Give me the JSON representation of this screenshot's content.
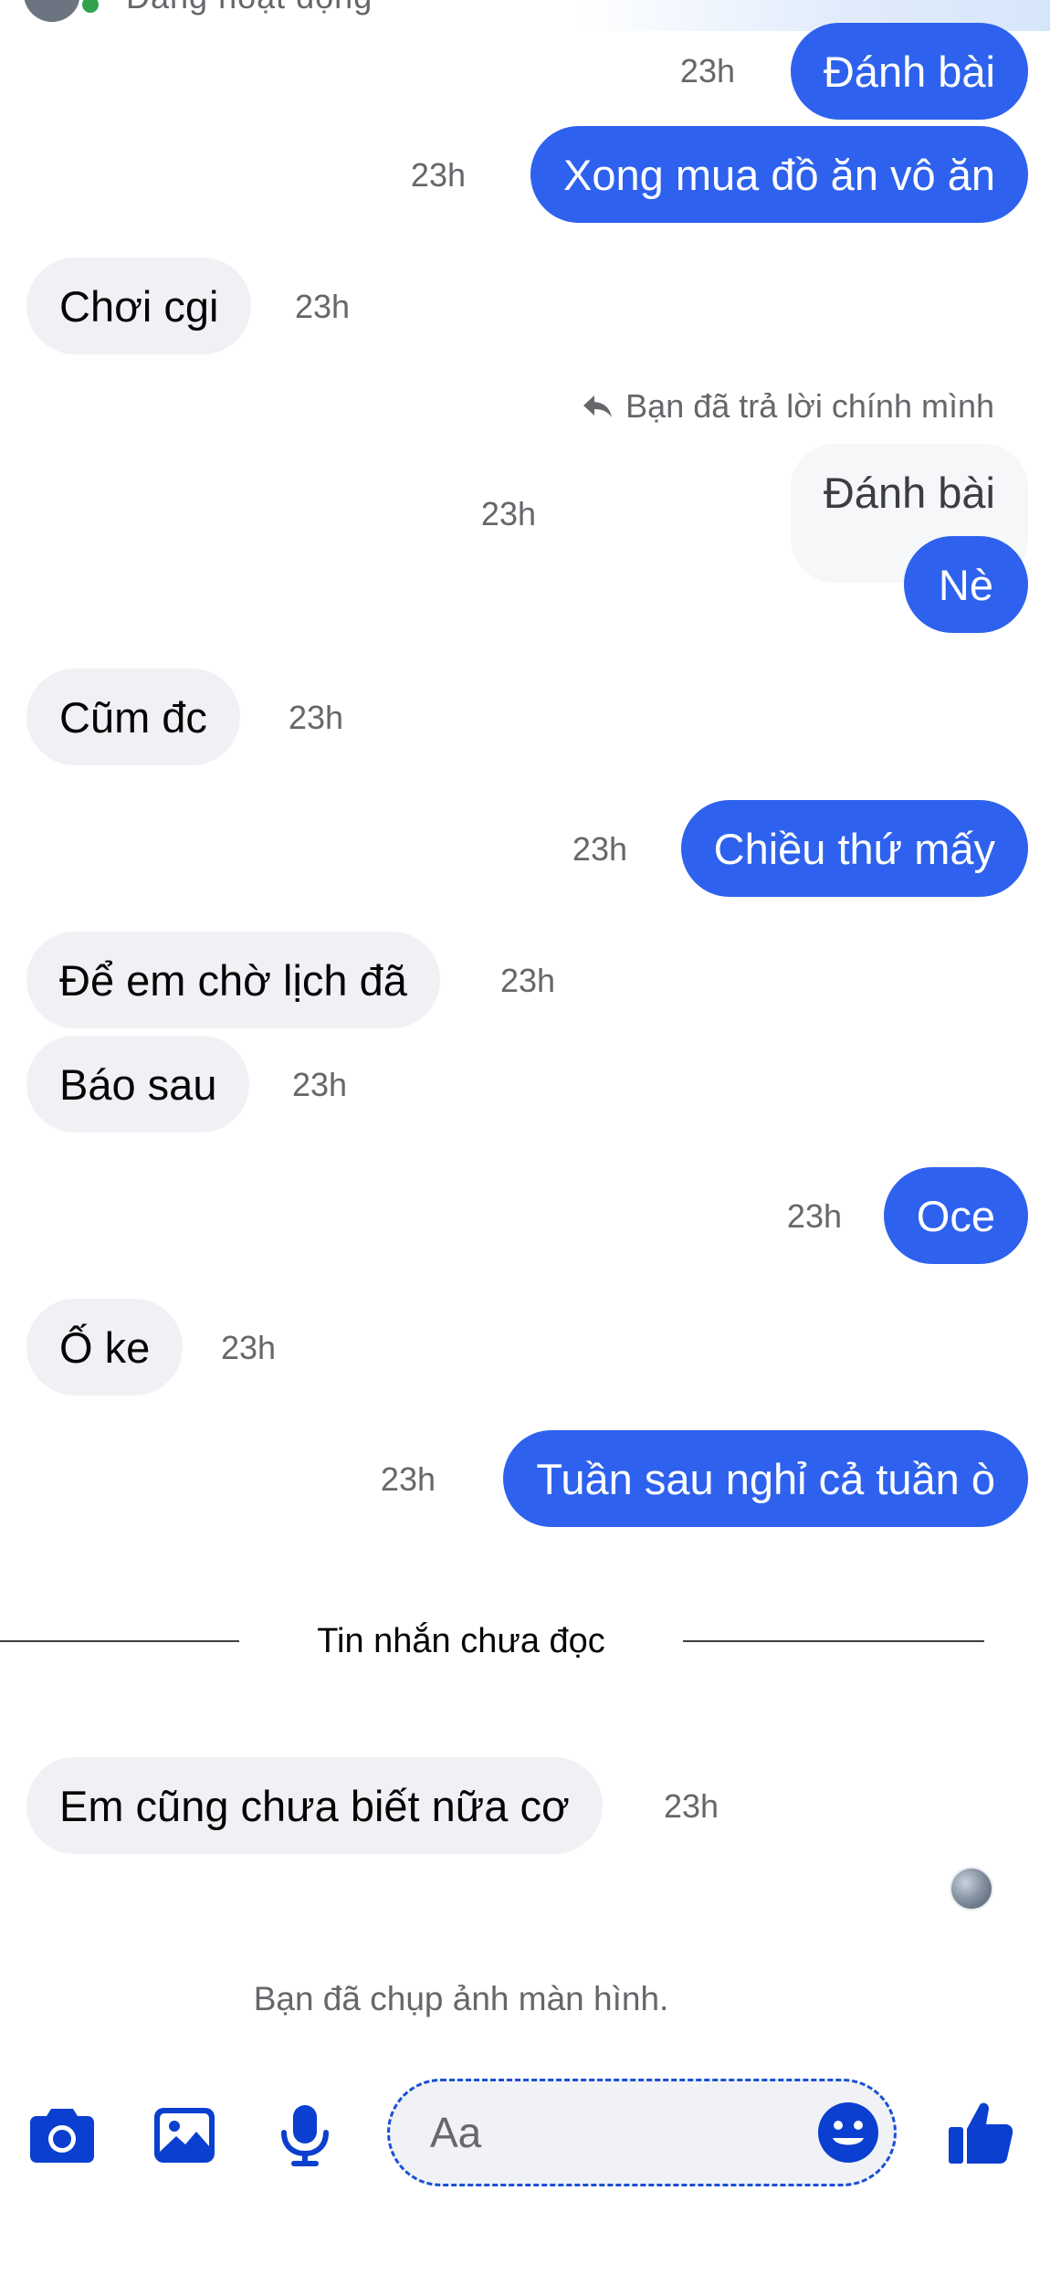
{
  "header": {
    "status_text": "Đang hoạt động"
  },
  "messages": [
    {
      "id": "m1",
      "side": "out",
      "text": "Đánh bài",
      "time": "23h"
    },
    {
      "id": "m2",
      "side": "out",
      "text": "Xong mua đồ ăn vô ăn",
      "time": "23h"
    },
    {
      "id": "m3",
      "side": "in",
      "text": "Chơi cgi",
      "time": "23h"
    },
    {
      "id": "m4",
      "side": "out",
      "reply_note": "Bạn đã trả lời chính mình",
      "quoted": "Đánh bài",
      "text": "Nè",
      "time": "23h"
    },
    {
      "id": "m5",
      "side": "in",
      "text": "Cũm đc",
      "time": "23h"
    },
    {
      "id": "m6",
      "side": "out",
      "text": "Chiều thứ mấy",
      "time": "23h"
    },
    {
      "id": "m7",
      "side": "in",
      "text": "Để em chờ lịch đã",
      "time": "23h"
    },
    {
      "id": "m8",
      "side": "in",
      "text": "Báo sau",
      "time": "23h"
    },
    {
      "id": "m9",
      "side": "out",
      "text": "Oce",
      "time": "23h"
    },
    {
      "id": "m10",
      "side": "in",
      "text": "Ố ke",
      "time": "23h"
    },
    {
      "id": "m11",
      "side": "out",
      "text": "Tuần sau nghỉ cả tuần ò",
      "time": "23h"
    },
    {
      "id": "m12",
      "side": "in",
      "text": "Em cũng chưa biết nữa cơ",
      "time": "23h"
    }
  ],
  "unread_divider": "Tin nhắn chưa đọc",
  "system_note": "Bạn đã chụp ảnh màn hình.",
  "composer": {
    "placeholder": "Aa",
    "icons": [
      "camera-icon",
      "image-icon",
      "microphone-icon",
      "emoji-icon",
      "like-icon"
    ]
  },
  "colors": {
    "outgoing_bubble": "#2e62ee",
    "incoming_bubble": "#f0f1f4",
    "accent_icon": "#0a3fcf"
  }
}
